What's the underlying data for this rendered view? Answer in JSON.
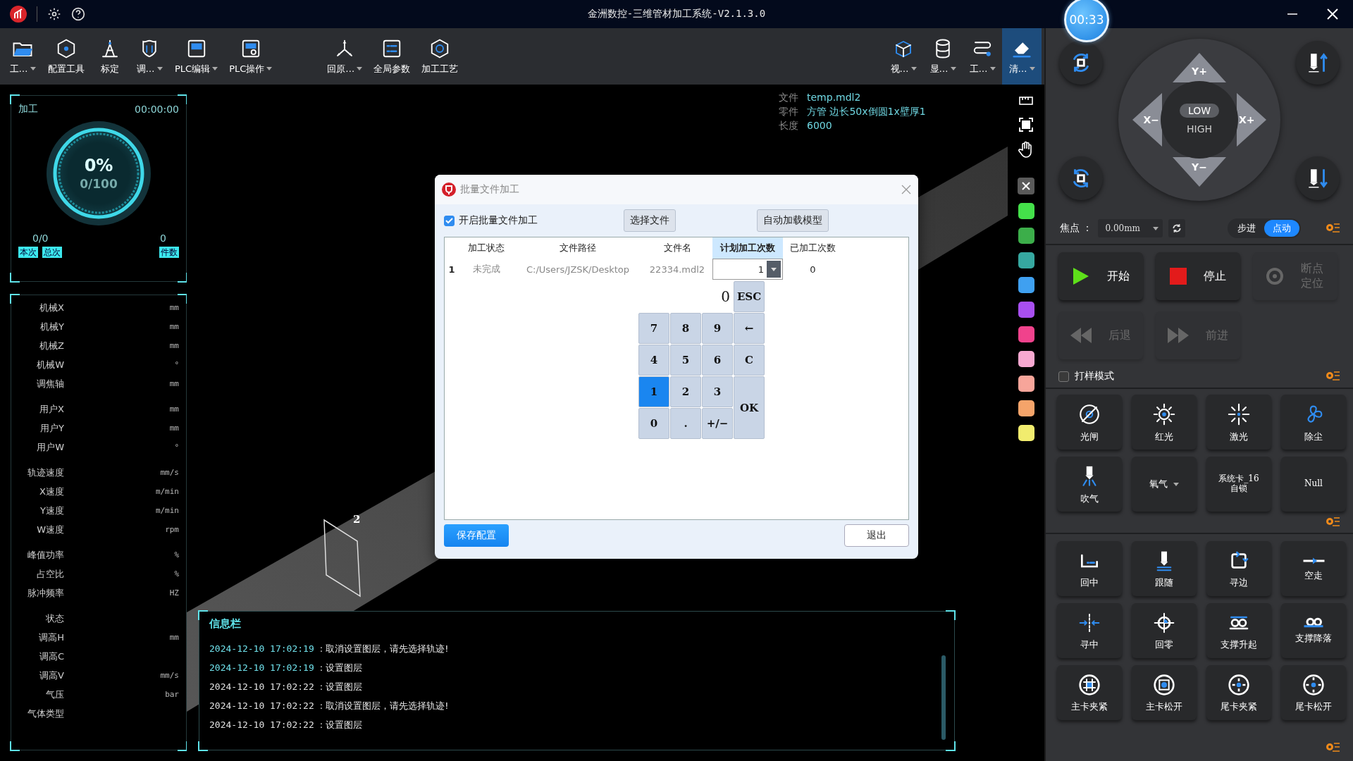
{
  "title_bar": {
    "title": "金洲数控-三维管材加工系统-V2.1.3.0",
    "timer": "00:33"
  },
  "toolbar": {
    "groups": [
      [
        {
          "label": "工…",
          "dropdown": true,
          "selected": false
        },
        {
          "label": "配置工具",
          "dropdown": false,
          "selected": false
        },
        {
          "label": "标定",
          "dropdown": false,
          "selected": false
        },
        {
          "label": "调…",
          "dropdown": true,
          "selected": false
        },
        {
          "label": "PLC编辑",
          "dropdown": true,
          "selected": false
        },
        {
          "label": "PLC操作",
          "dropdown": true,
          "selected": false
        }
      ],
      [
        {
          "label": "回原…",
          "dropdown": true,
          "selected": false
        },
        {
          "label": "全局参数",
          "dropdown": false,
          "selected": false
        },
        {
          "label": "加工工艺",
          "dropdown": false,
          "selected": false
        }
      ],
      [
        {
          "label": "视…",
          "dropdown": true,
          "selected": false
        },
        {
          "label": "显…",
          "dropdown": true,
          "selected": false
        },
        {
          "label": "工…",
          "dropdown": true,
          "selected": false
        },
        {
          "label": "清…",
          "dropdown": true,
          "selected": true
        }
      ]
    ]
  },
  "process": {
    "title": "加工",
    "time": "00:00:00",
    "percent": "0%",
    "progress": "0/100",
    "current": "0/0",
    "pieces": "0",
    "tags": [
      "本次",
      "总次"
    ],
    "pieces_tag": "件数"
  },
  "axes": {
    "groups": [
      [
        {
          "label": "机械X",
          "unit": "mm"
        },
        {
          "label": "机械Y",
          "unit": "mm"
        },
        {
          "label": "机械Z",
          "unit": "mm"
        },
        {
          "label": "机械W",
          "unit": "°"
        },
        {
          "label": "调焦轴",
          "unit": "mm"
        }
      ],
      [
        {
          "label": "用户X",
          "unit": "mm"
        },
        {
          "label": "用户Y",
          "unit": "mm"
        },
        {
          "label": "用户W",
          "unit": "°"
        }
      ],
      [
        {
          "label": "轨迹速度",
          "unit": "mm/s"
        },
        {
          "label": "X速度",
          "unit": "m/min"
        },
        {
          "label": "Y速度",
          "unit": "m/min"
        },
        {
          "label": "W速度",
          "unit": "rpm"
        }
      ],
      [
        {
          "label": "峰值功率",
          "unit": "%"
        },
        {
          "label": "占空比",
          "unit": "%"
        },
        {
          "label": "脉冲频率",
          "unit": "HZ"
        }
      ],
      [
        {
          "label": "状态"
        },
        {
          "label": "调高H",
          "unit": "mm"
        },
        {
          "label": "调高C"
        },
        {
          "label": "调高V",
          "unit": "mm/s"
        },
        {
          "label": "气压",
          "unit": "bar"
        },
        {
          "label": "气体类型"
        }
      ]
    ]
  },
  "file_info": [
    {
      "label": "文件",
      "value": "temp.mdl2"
    },
    {
      "label": "零件",
      "value": "方管 边长50x倒圆1x壁厚1"
    },
    {
      "label": "长度",
      "value": "6000"
    }
  ],
  "view": {
    "marker": "2"
  },
  "swatches": [
    {
      "color": "#44e04a"
    },
    {
      "color": "#3cae4a"
    },
    {
      "color": "#36a8a0"
    },
    {
      "color": "#3fa0f0"
    },
    {
      "color": "#a84ff0"
    },
    {
      "color": "#f0428c"
    },
    {
      "color": "#f7a8d0"
    },
    {
      "color": "#f7a59a"
    },
    {
      "color": "#f5a46a"
    },
    {
      "color": "#f1ec6e"
    }
  ],
  "dialog": {
    "title": "批量文件加工",
    "enable": {
      "label": "开启批量文件加工",
      "checked": true
    },
    "select_button": "选择文件",
    "auto_load_button": "自动加载模型",
    "columns": [
      {
        "label": "加工状态",
        "selected": false
      },
      {
        "label": "文件路径",
        "selected": false
      },
      {
        "label": "文件名",
        "selected": false
      },
      {
        "label": "计划加工次数",
        "selected": true
      },
      {
        "label": "已加工次数",
        "selected": false
      }
    ],
    "rows": [
      {
        "index": "1",
        "status": "未完成",
        "path": "C:/Users/JZSK/Desktop",
        "name": "22334.mdl2",
        "planned": "1",
        "done": "0"
      }
    ],
    "keypad": {
      "display": "0",
      "keys": [
        {
          "label": "ESC",
          "kind": "key",
          "selected": false
        },
        {
          "label": "7",
          "kind": "key",
          "selected": false
        },
        {
          "label": "8",
          "kind": "key",
          "selected": false
        },
        {
          "label": "9",
          "kind": "key",
          "selected": false
        },
        {
          "label": "←",
          "kind": "key",
          "selected": false
        },
        {
          "label": "4",
          "kind": "key",
          "selected": false
        },
        {
          "label": "5",
          "kind": "key",
          "selected": false
        },
        {
          "label": "6",
          "kind": "key",
          "selected": false
        },
        {
          "label": "C",
          "kind": "key",
          "selected": false
        },
        {
          "label": "1",
          "kind": "key",
          "selected": true
        },
        {
          "label": "2",
          "kind": "key",
          "selected": false
        },
        {
          "label": "3",
          "kind": "key",
          "selected": false
        },
        {
          "label": "OK",
          "kind": "tall",
          "selected": false
        },
        {
          "label": "0",
          "kind": "key",
          "selected": false
        },
        {
          "label": ".",
          "kind": "key",
          "selected": false
        },
        {
          "label": "+/−",
          "kind": "key",
          "selected": false
        }
      ]
    },
    "save_button": "保存配置",
    "exit_button": "退出"
  },
  "info_bar": {
    "title": "信息栏",
    "lines": [
      {
        "time": "2024-12-10 17:02:19",
        "message": ": 取消设置图层，请先选择轨迹!",
        "highlighted": true
      },
      {
        "time": "2024-12-10 17:02:19",
        "message": ": 设置图层",
        "highlighted": true
      },
      {
        "time": "2024-12-10 17:02:22",
        "message": ": 设置图层",
        "highlighted": false
      },
      {
        "time": "2024-12-10 17:02:22",
        "message": ": 取消设置图层，请先选择轨迹!",
        "highlighted": false
      },
      {
        "time": "2024-12-10 17:02:22",
        "message": ": 设置图层",
        "highlighted": false
      }
    ]
  },
  "right_panel": {
    "jog": {
      "speeds": [
        {
          "label": "LOW",
          "selected": true
        },
        {
          "label": "HIGH",
          "selected": false
        }
      ],
      "arrows": [
        {
          "label": "Y+",
          "kind": "up"
        },
        {
          "label": "X−",
          "kind": "left"
        },
        {
          "label": "X+",
          "kind": "right"
        },
        {
          "label": "Y−",
          "kind": "down"
        }
      ]
    },
    "focus": {
      "label": "焦点 ：",
      "value": "0.00mm"
    },
    "modes": [
      {
        "label": "步进",
        "selected": false
      },
      {
        "label": "点动",
        "selected": true
      }
    ],
    "controls": [
      {
        "label": "开始",
        "kind": "start",
        "disabled": false
      },
      {
        "label": "停止",
        "kind": "stop",
        "disabled": false
      },
      {
        "label": "断点定位",
        "kind": "breakpoint",
        "disabled": true
      },
      {
        "label": "后退",
        "kind": "back",
        "disabled": true
      },
      {
        "label": "前进",
        "kind": "forward",
        "disabled": true
      }
    ],
    "sample_mode": {
      "label": "打样模式",
      "checked": false
    },
    "io": [
      {
        "label": "光闸",
        "kind": "icon"
      },
      {
        "label": "红光",
        "kind": "icon"
      },
      {
        "label": "激光",
        "kind": "icon"
      },
      {
        "label": "除尘",
        "kind": "icon"
      },
      {
        "label": "吹气",
        "kind": "icon"
      },
      {
        "label": "氧气",
        "kind": "select"
      },
      {
        "label": "系统卡_16 自锁",
        "kind": "text"
      },
      {
        "label": "Null",
        "kind": "text"
      }
    ],
    "motion": [
      {
        "label": "回中"
      },
      {
        "label": "跟随"
      },
      {
        "label": "寻边"
      },
      {
        "label": "空走"
      },
      {
        "label": "寻中"
      },
      {
        "label": "回零"
      },
      {
        "label": "支撑升起"
      },
      {
        "label": "支撑降落"
      },
      {
        "label": "主卡夹紧"
      },
      {
        "label": "主卡松开"
      },
      {
        "label": "尾卡夹紧"
      },
      {
        "label": "尾卡松开"
      }
    ]
  }
}
